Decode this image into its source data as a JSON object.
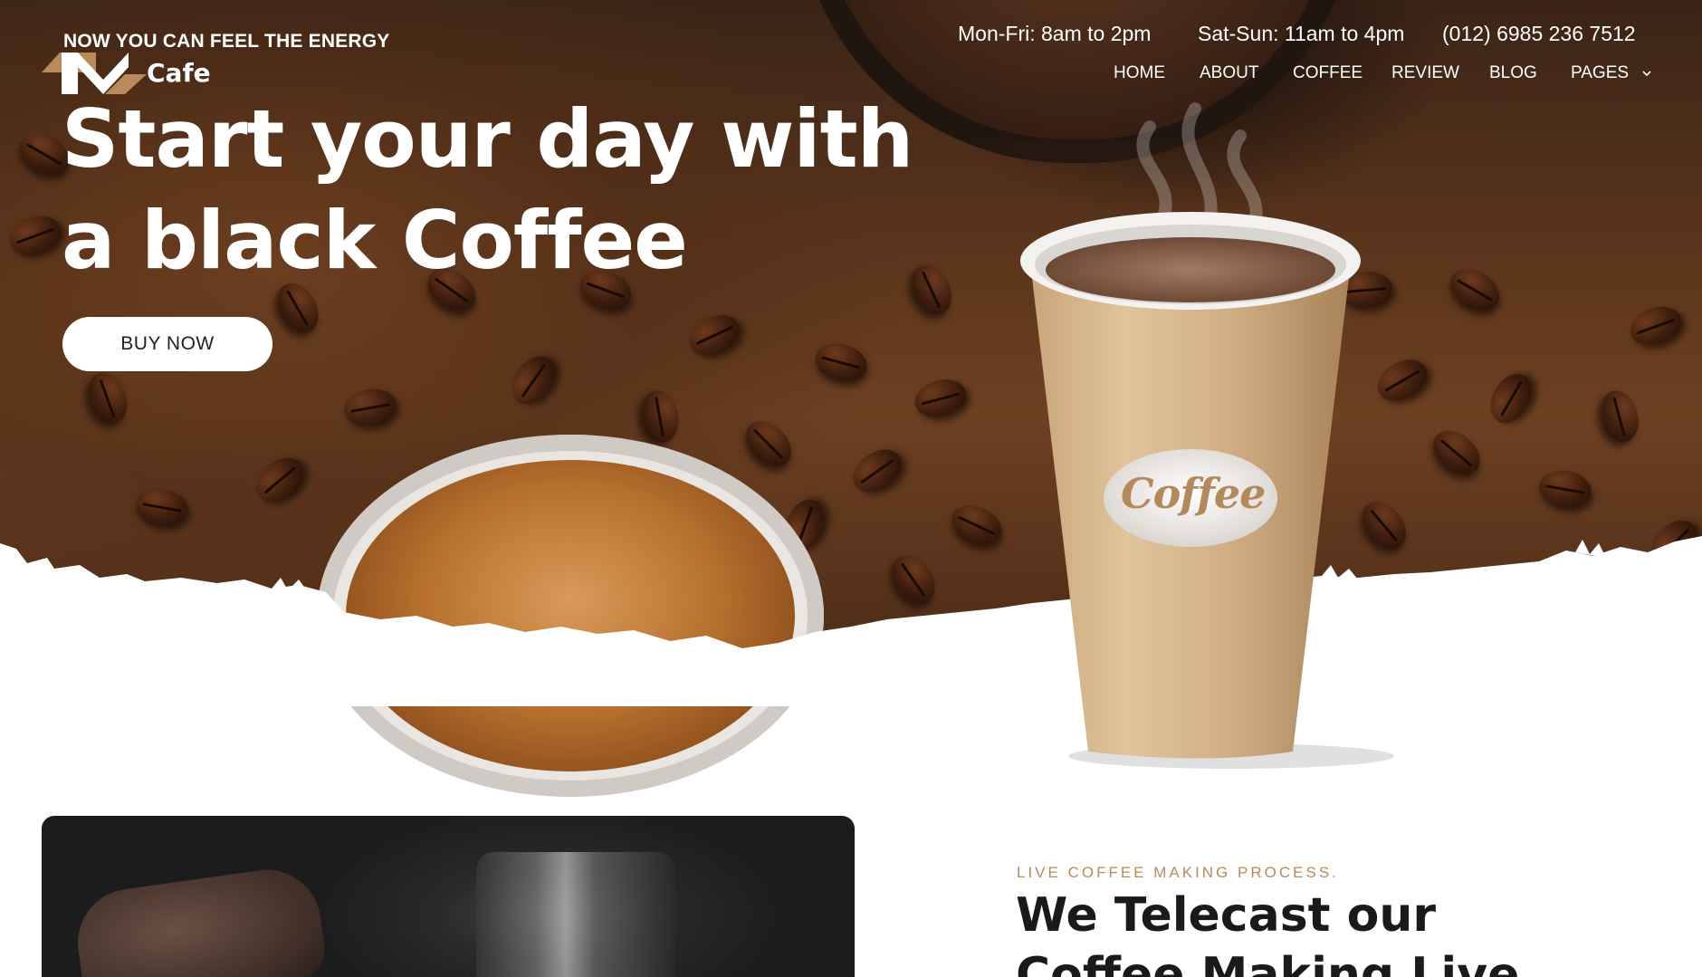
{
  "header": {
    "tagline": "NOW YOU CAN FEEL THE ENERGY",
    "logo_text": "Cafe",
    "hours_weekday": "Mon-Fri: 8am to 2pm",
    "hours_weekend": "Sat-Sun: 11am to 4pm",
    "phone": "(012) 6985 236 7512",
    "nav": [
      {
        "label": "HOME"
      },
      {
        "label": "ABOUT"
      },
      {
        "label": "COFFEE"
      },
      {
        "label": "REVIEW"
      },
      {
        "label": "BLOG"
      },
      {
        "label": "PAGES"
      }
    ]
  },
  "hero": {
    "headline_line1": "Start your day with",
    "headline_line2": "a black Coffee",
    "cta_label": "BUY NOW",
    "cup_label": "Coffee"
  },
  "section": {
    "eyebrow": "LIVE COFFEE MAKING PROCESS.",
    "title_line1": "We Telecast our",
    "title_line2": "Coffee Making Live"
  },
  "colors": {
    "accent": "#b88a5c",
    "text_dark": "#1a1a1a",
    "white": "#ffffff"
  }
}
